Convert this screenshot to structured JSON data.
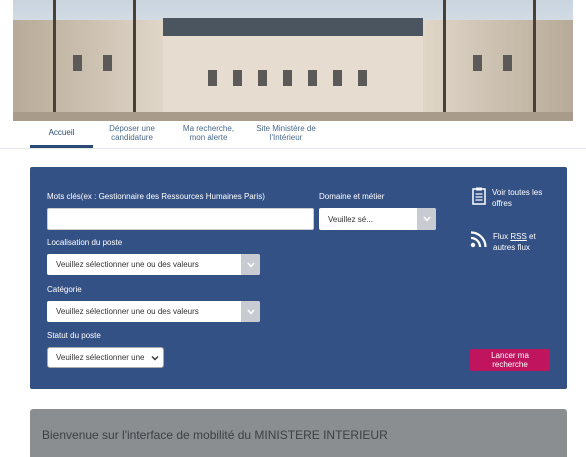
{
  "nav": {
    "tabs": [
      {
        "label": "Accueil",
        "active": true
      },
      {
        "label": "Déposer une\ncandidature"
      },
      {
        "label": "Ma recherche,\nmon alerte"
      },
      {
        "label": "Site Ministère de\nl'Intérieur"
      }
    ]
  },
  "search": {
    "keywords_label": "Mots clés(ex : Gestionnaire des Ressources Humaines Paris)",
    "keywords_value": "",
    "domain_label": "Domaine et métier",
    "domain_value": "Veuillez sé...",
    "location_label": "Localisation du poste",
    "location_value": "Veuillez sélectionner une ou des valeurs",
    "category_label": "Catégorie",
    "category_value": "Veuillez sélectionner une ou des valeurs",
    "status_label": "Statut du poste",
    "status_value": "Veuillez sélectionner une",
    "submit_label": "Lancer ma\nrecherche"
  },
  "side_links": {
    "offers_label": "Voir toutes les\noffres",
    "rss_prefix": "Flux ",
    "rss_abbr": "RSS",
    "rss_suffix": " et\nautres flux"
  },
  "welcome": {
    "message": "Bienvenue sur l'interface de mobilité du MINISTERE INTERIEUR"
  },
  "colors": {
    "panel": "#345185",
    "button": "#c0155e",
    "welcome_bar": "#8b8e91"
  },
  "icons": [
    "clipboard-icon",
    "rss-icon",
    "chevron-down-icon"
  ]
}
